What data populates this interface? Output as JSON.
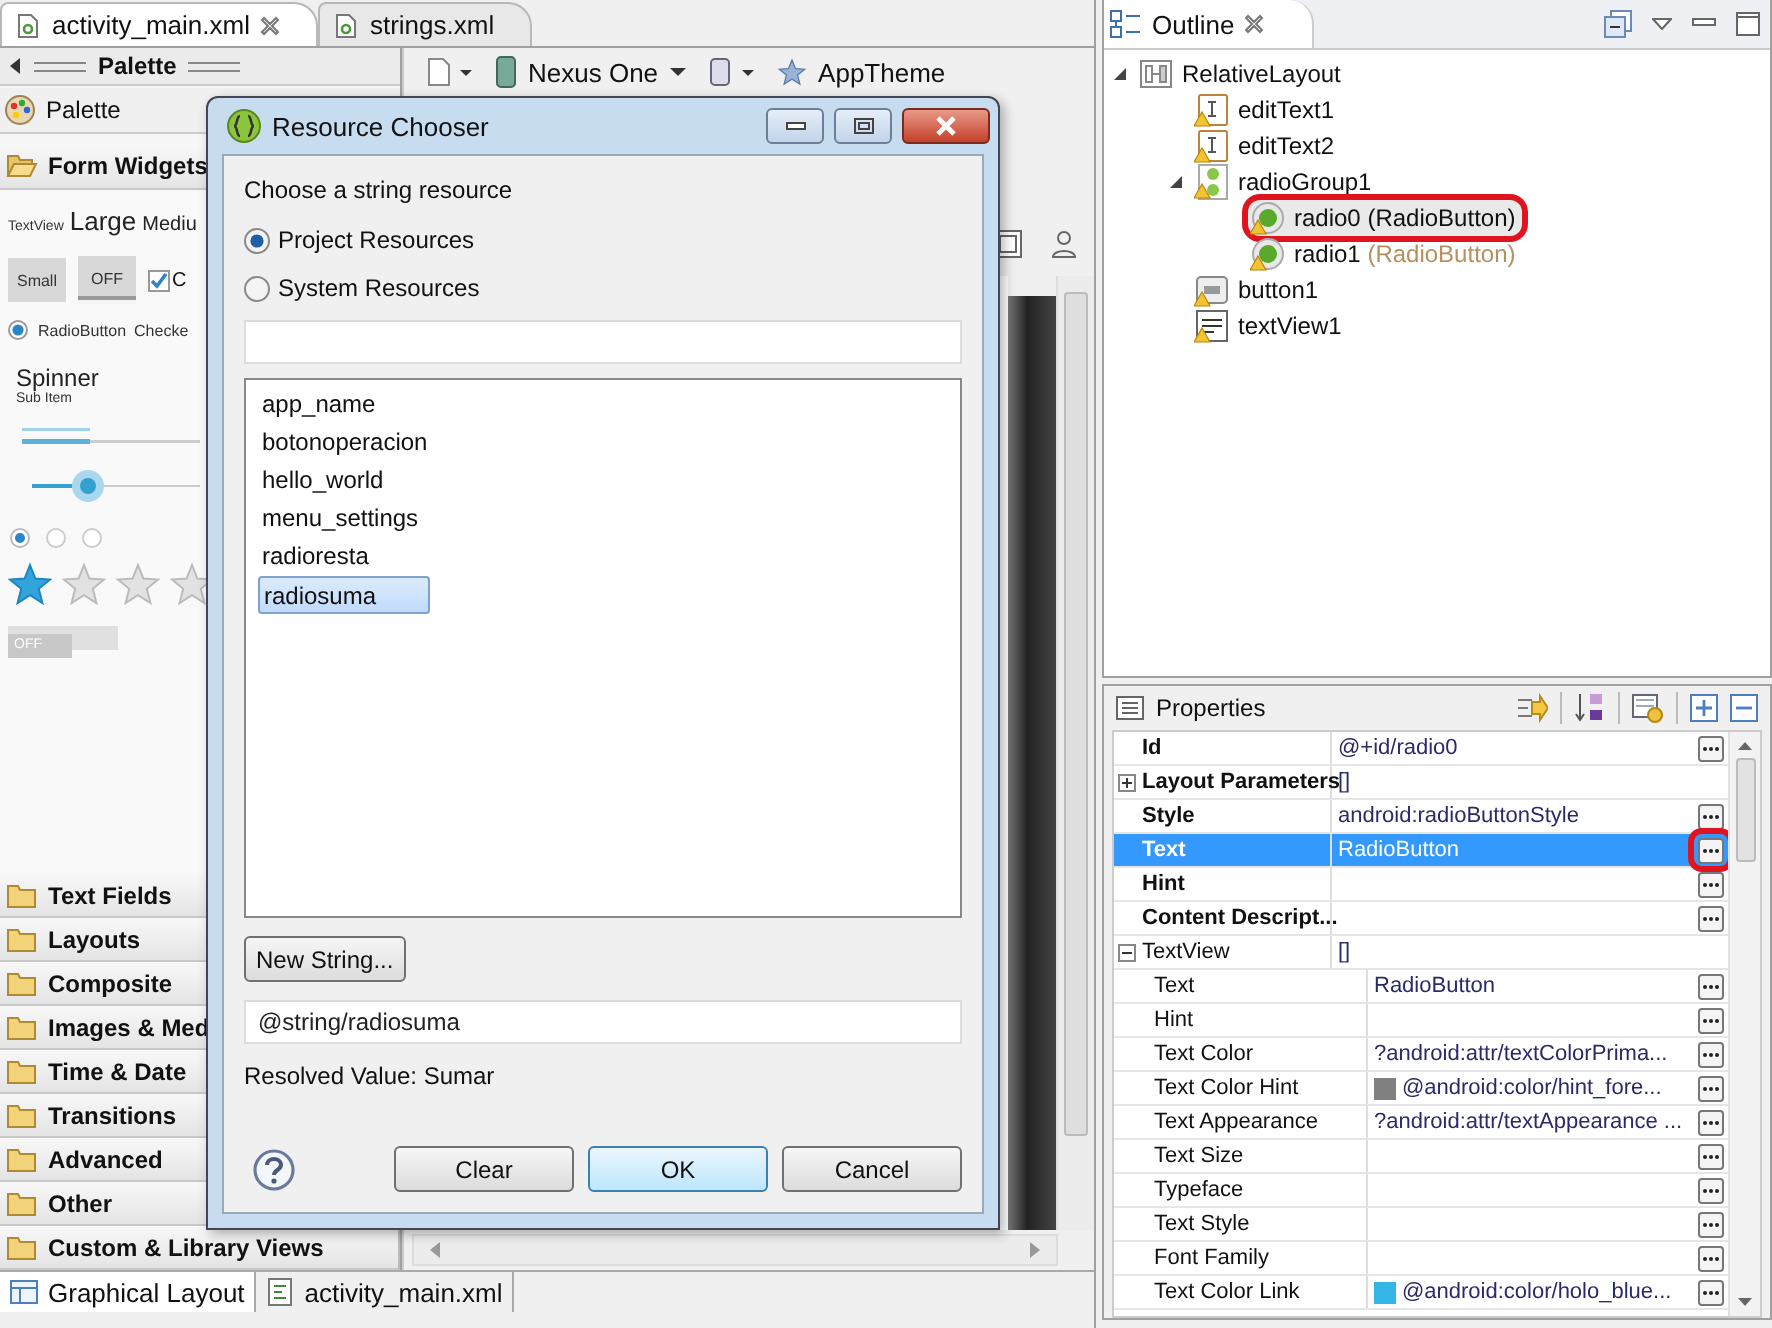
{
  "editor_tabs": [
    {
      "label": "activity_main.xml",
      "selected": true,
      "closable": true
    },
    {
      "label": "strings.xml",
      "selected": false,
      "closable": false
    }
  ],
  "palette": {
    "title": "Palette",
    "header": "Palette",
    "drawers": [
      {
        "label": "Form Widgets",
        "expanded": true
      },
      {
        "label": "Text Fields",
        "expanded": false
      },
      {
        "label": "Layouts",
        "expanded": false
      },
      {
        "label": "Composite",
        "expanded": false
      },
      {
        "label": "Images & Med",
        "expanded": false
      },
      {
        "label": "Time & Date",
        "expanded": false
      },
      {
        "label": "Transitions",
        "expanded": false
      },
      {
        "label": "Advanced",
        "expanded": false
      },
      {
        "label": "Other",
        "expanded": false
      },
      {
        "label": "Custom & Library Views",
        "expanded": false
      }
    ],
    "widgets": {
      "textview": "TextView",
      "large": "Large",
      "medium": "Mediu",
      "small_button": "Small",
      "toggle": "OFF",
      "checkbox": {
        "label": "C",
        "checked": true
      },
      "radio": {
        "label": "RadioButton",
        "checked": true
      },
      "checked_text": "Checke",
      "spinner": "Spinner",
      "spinner_sub": "Sub Item",
      "rating": {
        "stars": 1
      },
      "switch": "OFF"
    }
  },
  "canvas_toolbar": {
    "device": "Nexus One",
    "theme": "AppTheme"
  },
  "bottom_tabs": [
    {
      "label": "Graphical Layout",
      "selected": true
    },
    {
      "label": "activity_main.xml",
      "selected": false
    }
  ],
  "outline": {
    "title": "Outline",
    "tree": [
      {
        "label": "RelativeLayout",
        "kind": "layout",
        "warning": false,
        "selected": false,
        "circled": false,
        "expanded": true,
        "children": [
          {
            "label": "editText1",
            "kind": "edittext",
            "warning": true,
            "selected": false,
            "circled": false
          },
          {
            "label": "editText2",
            "kind": "edittext",
            "warning": true,
            "selected": false,
            "circled": false
          },
          {
            "label": "radioGroup1",
            "kind": "radiogroup",
            "warning": true,
            "selected": false,
            "circled": false,
            "expanded": true,
            "children": [
              {
                "label": "radio0",
                "type": "(RadioButton)",
                "kind": "radio",
                "warning": true,
                "selected": true,
                "circled": true
              },
              {
                "label": "radio1",
                "type": "(RadioButton)",
                "kind": "radio",
                "warning": true,
                "selected": false,
                "circled": false
              }
            ]
          },
          {
            "label": "button1",
            "kind": "button",
            "warning": true,
            "selected": false,
            "circled": false
          },
          {
            "label": "textView1",
            "kind": "textview",
            "warning": true,
            "selected": false,
            "circled": false
          }
        ]
      }
    ]
  },
  "properties": {
    "title": "Properties",
    "rows": [
      {
        "name": "Id",
        "value": "@+id/radio0",
        "selected": false,
        "circled": false
      },
      {
        "name": "Layout Parameters",
        "value": "[]",
        "selected": false,
        "circled": false,
        "expanded": false,
        "children": []
      },
      {
        "name": "Style",
        "value": "android:radioButtonStyle",
        "selected": false,
        "circled": false
      },
      {
        "name": "Text",
        "value": "RadioButton",
        "selected": true,
        "circled": true
      },
      {
        "name": "Hint",
        "selected": false,
        "circled": false
      },
      {
        "name": "Content Descript...",
        "selected": false,
        "circled": false
      },
      {
        "name": "TextView",
        "value": "[]",
        "selected": false,
        "circled": false,
        "expanded": true,
        "children": [
          {
            "name": "Text",
            "value": "RadioButton",
            "selected": false,
            "circled": false
          },
          {
            "name": "Hint",
            "selected": false,
            "circled": false
          },
          {
            "name": "Text Color",
            "value": "?android:attr/textColorPrima...",
            "selected": false,
            "circled": false
          },
          {
            "name": "Text Color Hint",
            "value": "@android:color/hint_fore...",
            "color": "#808080",
            "selected": false,
            "circled": false
          },
          {
            "name": "Text Appearance",
            "value": "?android:attr/textAppearance ...",
            "selected": false,
            "circled": false
          },
          {
            "name": "Text Size",
            "selected": false,
            "circled": false
          },
          {
            "name": "Typeface",
            "selected": false,
            "circled": false
          },
          {
            "name": "Text Style",
            "selected": false,
            "circled": false
          },
          {
            "name": "Font Family",
            "selected": false,
            "circled": false
          },
          {
            "name": "Text Color Link",
            "value": "@android:color/holo_blue...",
            "color": "#33b5e5",
            "selected": false,
            "circled": false
          }
        ]
      }
    ]
  },
  "dialog": {
    "title": "Resource Chooser",
    "prompt": "Choose a string resource",
    "sources": [
      {
        "label": "Project Resources",
        "selected": true
      },
      {
        "label": "System Resources",
        "selected": false
      }
    ],
    "resources": [
      {
        "label": "app_name",
        "selected": false
      },
      {
        "label": "botonoperacion",
        "selected": false
      },
      {
        "label": "hello_world",
        "selected": false
      },
      {
        "label": "menu_settings",
        "selected": false
      },
      {
        "label": "radioresta",
        "selected": false
      },
      {
        "label": "radiosuma",
        "selected": true
      }
    ],
    "new_button": "New String...",
    "reference": "@string/radiosuma",
    "resolved": "Resolved Value: Sumar",
    "buttons": [
      {
        "label": "Clear",
        "default": false
      },
      {
        "label": "OK",
        "default": true
      },
      {
        "label": "Cancel",
        "default": false
      }
    ]
  }
}
